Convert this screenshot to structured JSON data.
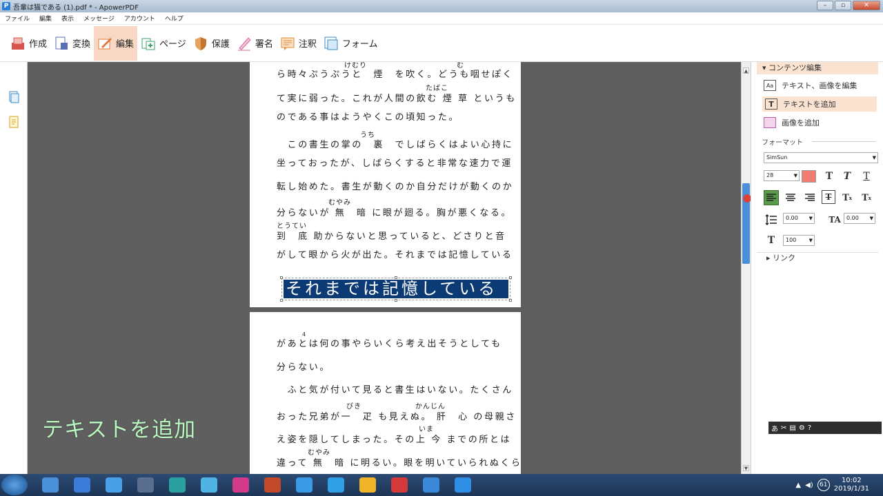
{
  "window": {
    "title": "吾輩は猫である (1).pdf * - ApowerPDF",
    "controls": [
      "–",
      "▫",
      "✕"
    ]
  },
  "menu": [
    "ファイル",
    "編集",
    "表示",
    "メッセージ",
    "アカウント",
    "ヘルプ"
  ],
  "toolbar": {
    "items": [
      {
        "label": "作成",
        "icon": "create-icon",
        "color": "#d9534f"
      },
      {
        "label": "変換",
        "icon": "convert-icon",
        "color": "#5b6fb5"
      },
      {
        "label": "編集",
        "icon": "edit-icon",
        "color": "#e07a3a",
        "active": true
      },
      {
        "label": "ページ",
        "icon": "page-icon",
        "color": "#3aa36b"
      },
      {
        "label": "保護",
        "icon": "protect-icon",
        "color": "#c4762e"
      },
      {
        "label": "署名",
        "icon": "sign-icon",
        "color": "#d56b9c"
      },
      {
        "label": "注釈",
        "icon": "annotate-icon",
        "color": "#e08a3a"
      },
      {
        "label": "フォーム",
        "icon": "form-icon",
        "color": "#3a8ac4"
      }
    ]
  },
  "document": {
    "page1_lines": [
      "ら時々ぷうぷうと　煙　を吹く。どうも咽せぽく",
      "て実に弱った。これが人間の飲む 煙 草 というも",
      "のである事はようやくこの頃知った。",
      "　この書生の掌の　裏　でしばらくはよい心持に",
      "坐っておったが、しばらくすると非常な速力で運",
      "転し始めた。書生が動くのか自分だけが動くのか",
      "分らないが 無　暗 に眼が廻る。胸が悪くなる。",
      " 到　底 助からないと思っていると、どさりと音",
      "がして眼から火が出た。それまでは記憶している"
    ],
    "page1_ruby": [
      "けむり",
      "む",
      "たばこ",
      "うち",
      "むやみ",
      "とうてい"
    ],
    "selected_text": "それまでは記憶している",
    "page2_lines": [
      "があとは何の事やらいくら考え出そうとしても",
      "分らない。",
      "　ふと気が付いて見ると書生はいない。たくさん",
      "おった兄弟が一　疋 も見えぬ。 肝　心 の母親さ",
      "え姿を隠してしまった。その上 今 までの所とは",
      "違って 無　暗 に明るい。眼を明いていられぬくら"
    ],
    "page2_ruby": [
      "4",
      "ぴき",
      "かんじん",
      "いま",
      "むやみ"
    ],
    "overlay_caption": "テキストを追加"
  },
  "panel": {
    "section_title": "コンテンツ編集",
    "items": [
      {
        "label": "テキスト、画像を編集",
        "icon": "edit-text-image-icon"
      },
      {
        "label": "テキストを追加",
        "icon": "add-text-icon",
        "active": true
      },
      {
        "label": "画像を追加",
        "icon": "add-image-icon"
      }
    ],
    "format_label": "フォーマット",
    "font": "SimSun",
    "font_size": "28",
    "color": "#f07c74",
    "char_spacing": "0.00",
    "line_spacing": "0.00",
    "scale": "100",
    "link_label": "リンク"
  },
  "taskbar": {
    "time": "10:02",
    "date": "2019/1/31",
    "badge": "61",
    "apps": [
      "#4a90d9",
      "#3d7bd8",
      "#4aa0e6",
      "#5a6f8f",
      "#2aa0a0",
      "#4fb3e6",
      "#d43a8a",
      "#c24a2a",
      "#3a9ae6",
      "#2f9fe6",
      "#f0b428",
      "#d43a3a",
      "#3a88d8",
      "#2f8fe6"
    ]
  }
}
